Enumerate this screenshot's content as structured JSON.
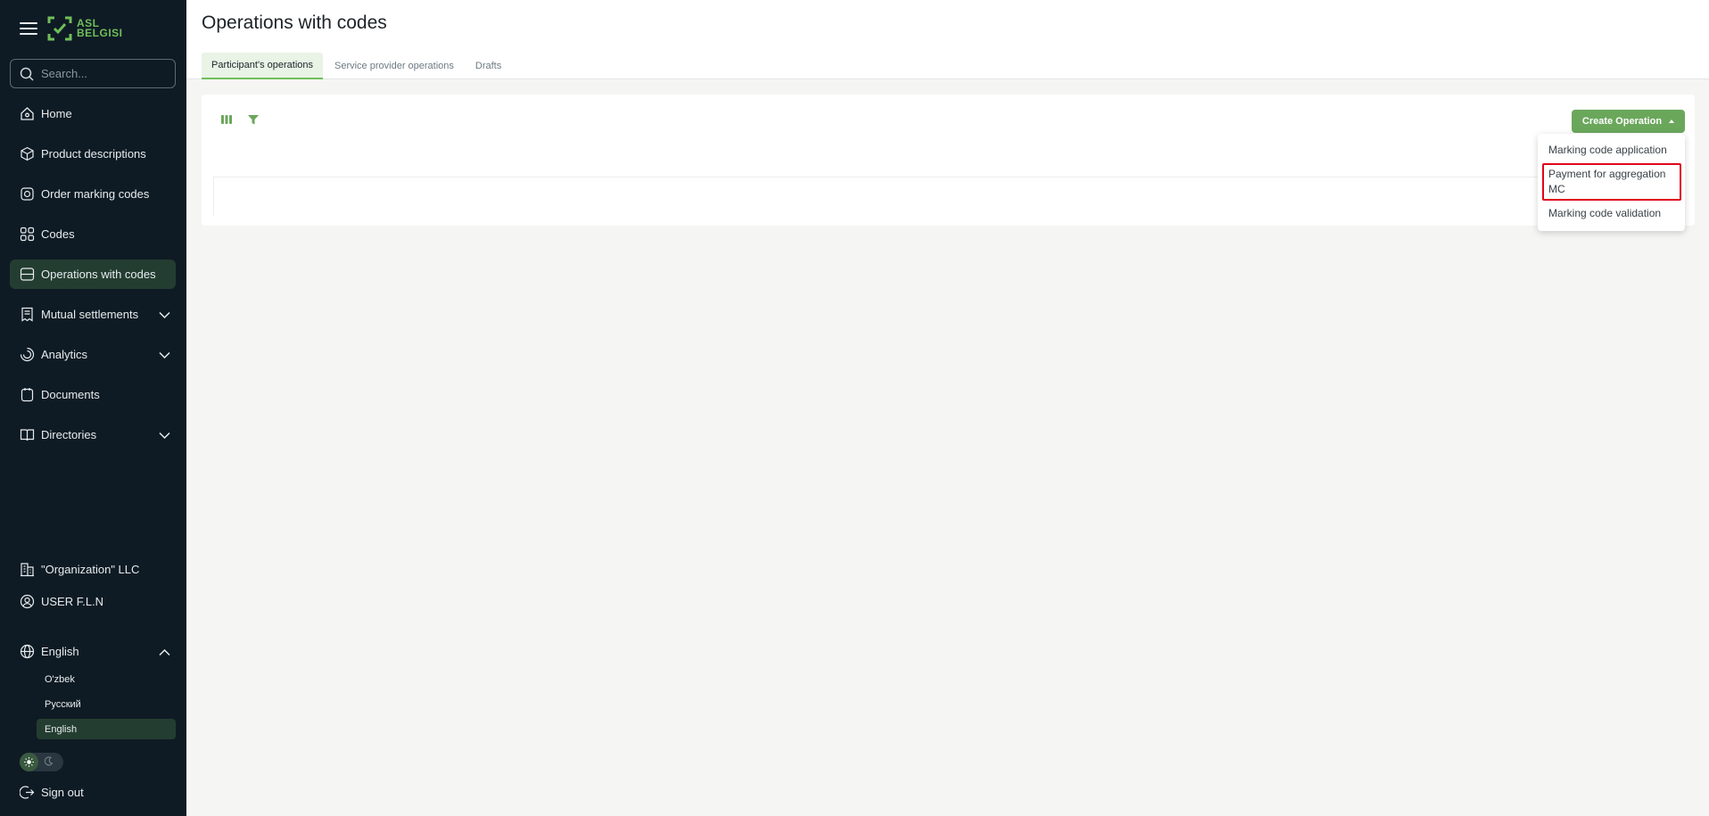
{
  "sidebar": {
    "logo_line1": "ASL",
    "logo_line2": "BELGISI",
    "search_placeholder": "Search...",
    "nav": {
      "home": "Home",
      "product_descriptions": "Product descriptions",
      "order_marking_codes": "Order marking codes",
      "codes": "Codes",
      "operations_with_codes": "Operations with codes",
      "mutual_settlements": "Mutual settlements",
      "analytics": "Analytics",
      "documents": "Documents",
      "directories": "Directories"
    },
    "organization": "\"Organization\" LLC",
    "user": "USER F.L.N",
    "language": {
      "current": "English",
      "options": [
        "O'zbek",
        "Русский",
        "English"
      ]
    },
    "sign_out": "Sign out"
  },
  "header": {
    "title": "Operations with codes",
    "tabs": [
      "Participant's operations",
      "Service provider operations",
      "Drafts"
    ]
  },
  "toolbar": {
    "create_label": "Create Operation"
  },
  "dropdown": {
    "items": [
      "Marking code application",
      "Payment for aggregation MC",
      "Marking code validation"
    ]
  },
  "colors": {
    "sidebar_bg": "#0f1b24",
    "accent": "#6aa75b",
    "highlight": "#e0001b"
  }
}
